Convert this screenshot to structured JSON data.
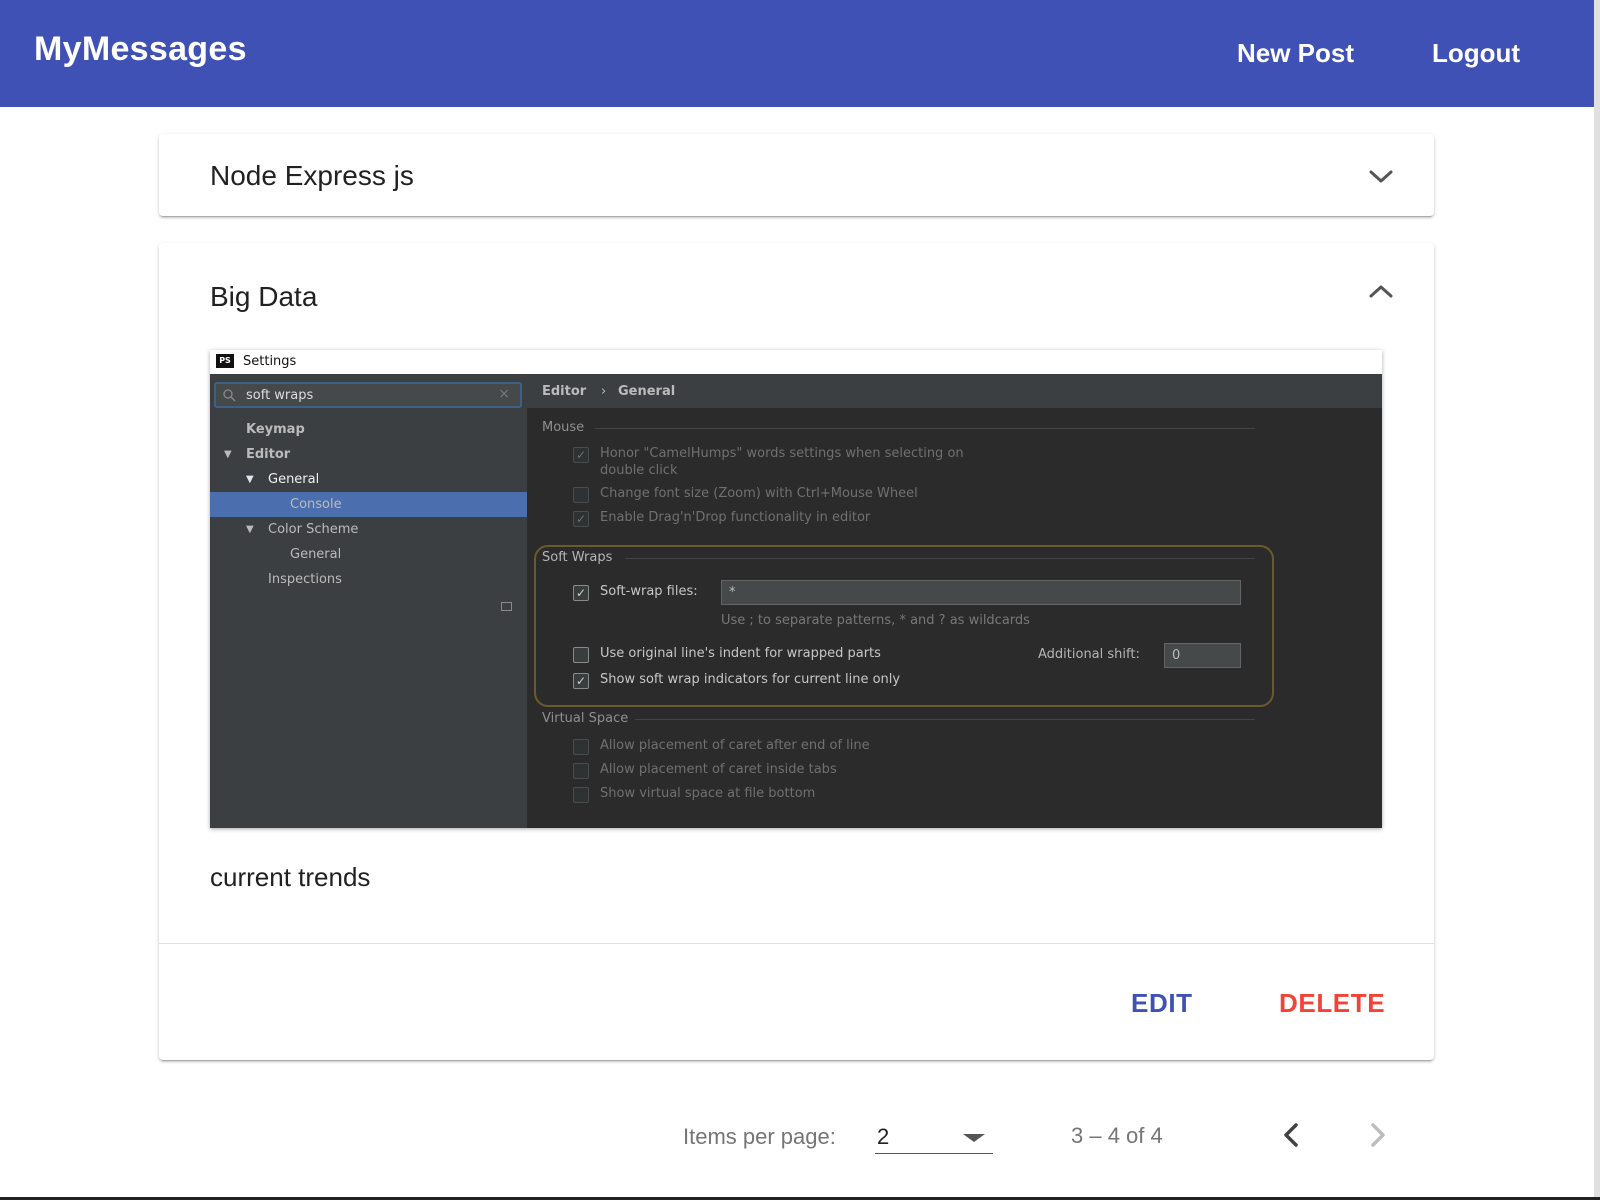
{
  "toolbar": {
    "brand": "MyMessages",
    "new_post": "New Post",
    "logout": "Logout"
  },
  "posts": [
    {
      "title": "Node Express js",
      "expanded": false
    },
    {
      "title": "Big Data",
      "expanded": true,
      "content": "current trends",
      "actions": {
        "edit": "EDIT",
        "delete": "DELETE"
      },
      "image": {
        "window_title": "Settings",
        "logo_text": "PS",
        "search_value": "soft wraps",
        "clear_glyph": "×",
        "tree": {
          "keymap": "Keymap",
          "editor": "Editor",
          "general": "General",
          "console": "Console",
          "color_scheme": "Color Scheme",
          "color_general": "General",
          "inspections": "Inspections"
        },
        "breadcrumb": {
          "first": "Editor",
          "sep": "›",
          "second": "General"
        },
        "mouse": {
          "label": "Mouse",
          "camel_humps_1": "Honor \"CamelHumps\" words settings when selecting on",
          "camel_humps_2": "double click",
          "zoom": "Change font size (Zoom) with Ctrl+Mouse Wheel",
          "drag_drop": "Enable Drag'n'Drop functionality in editor"
        },
        "soft_wraps": {
          "label": "Soft Wraps",
          "files_label": "Soft-wrap files:",
          "files_value": "*",
          "hint": "Use ; to separate patterns, * and ? as wildcards",
          "indent": "Use original line's indent for wrapped parts",
          "shift_label": "Additional shift:",
          "shift_value": "0",
          "indicators": "Show soft wrap indicators for current line only"
        },
        "virtual_space": {
          "label": "Virtual Space",
          "caret_eol": "Allow placement of caret after end of line",
          "caret_tabs": "Allow placement of caret inside tabs",
          "file_bottom": "Show virtual space at file bottom"
        },
        "check_glyph": "✓"
      }
    }
  ],
  "paginator": {
    "label": "Items per page:",
    "page_size": "2",
    "range": "3 – 4 of 4"
  },
  "colors": {
    "primary": "#3f51b5",
    "warn": "#f44336"
  }
}
